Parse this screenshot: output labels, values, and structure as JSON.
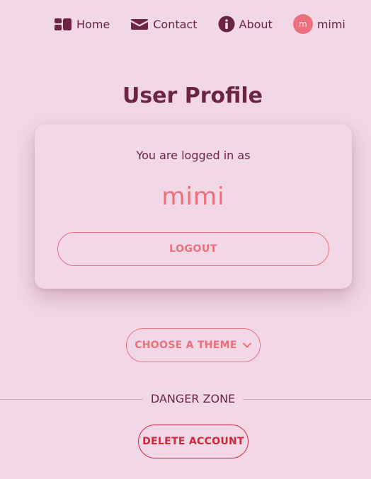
{
  "nav": {
    "items": [
      {
        "label": "Home",
        "icon": "home-icon"
      },
      {
        "label": "Contact",
        "icon": "envelope-icon"
      },
      {
        "label": "About",
        "icon": "info-icon"
      }
    ],
    "user": {
      "avatar_initial": "m",
      "name": "mimi"
    }
  },
  "profile": {
    "title": "User Profile",
    "logged_in_label": "You are logged in as",
    "username": "mimi",
    "logout_label": "LOGOUT"
  },
  "theme": {
    "button_label": "CHOOSE A THEME",
    "icon": "chevron-down-icon"
  },
  "danger": {
    "label": "DANGER ZONE",
    "delete_label": "DELETE ACCOUNT"
  },
  "colors": {
    "background": "#f2d7e6",
    "text": "#6b2540",
    "accent": "#ec6f7c",
    "danger": "#d3263b"
  }
}
